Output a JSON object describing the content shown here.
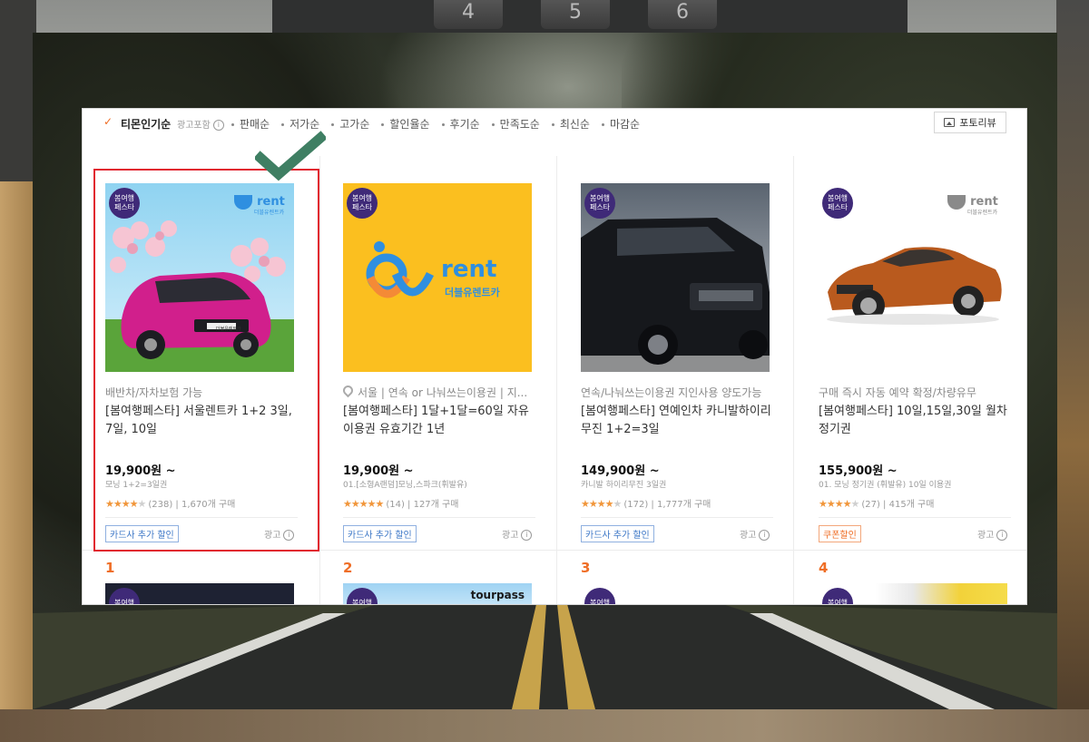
{
  "backdrop": {
    "keys": [
      "4",
      "5",
      "6"
    ]
  },
  "sort_bar": {
    "active_label": "티몬인기순",
    "ad_included": "광고포함",
    "items": [
      "판매순",
      "저가순",
      "고가순",
      "할인율순",
      "후기순",
      "만족도순",
      "최신순",
      "마감순"
    ],
    "photo_review_label": "포토리뷰"
  },
  "products": [
    {
      "badge": "봄여행 페스타",
      "brand_logo": "rent",
      "brand_logo_sub": "더블유렌트카",
      "car_plate": "더블유렌트카",
      "subtitle": "배반차/자차보험 가능",
      "title": "[봄여행페스타] 서울렌트카 1+2 3일, 7일, 10일",
      "price": "19,900원 ~",
      "option": "모닝 1+2=3일권",
      "rating_stars": 4.5,
      "review_count": "(238)",
      "sold": "1,670개 구매",
      "tag": "카드사 추가 할인",
      "tag_color": "blue",
      "ad": "광고"
    },
    {
      "badge": "봄여행 페스타",
      "brand_logo": "rent",
      "brand_logo_sub": "더블유렌트카",
      "subtitle": "서울 | 연속 or 나눠쓰는이용권 | 지...",
      "title": "[봄여행페스타] 1달+1달=60일 자유이용권 유효기간 1년",
      "price": "19,900원 ~",
      "option": "01.[소형A랜덤]모닝,스파크(휘발유)",
      "rating_stars": 5,
      "review_count": "(14)",
      "sold": "127개 구매",
      "tag": "카드사 추가 할인",
      "tag_color": "blue",
      "ad": "광고"
    },
    {
      "badge": "봄여행 페스타",
      "subtitle": "연속/나눠쓰는이용권 지인사용 양도가능",
      "title": "[봄여행페스타] 연예인차 카니발하이리무진 1+2=3일",
      "price": "149,900원 ~",
      "option": "카니발 하이리무진 3일권",
      "rating_stars": 4,
      "review_count": "(172)",
      "sold": "1,777개 구매",
      "tag": "카드사 추가 할인",
      "tag_color": "blue",
      "ad": "광고"
    },
    {
      "badge": "봄여행 페스타",
      "brand_logo": "rent",
      "brand_logo_sub": "더블유렌트카",
      "subtitle": "구매 즉시 자동 예약 확정/차량유무",
      "title": "[봄여행페스타] 10일,15일,30일 월차 정기권",
      "price": "155,900원 ~",
      "option": "01. 모닝 정기권 (휘발유) 10일 이용권",
      "rating_stars": 4,
      "review_count": "(27)",
      "sold": "415개 구매",
      "tag": "쿠폰할인",
      "tag_color": "orange",
      "ad": "광고"
    }
  ],
  "next_row": [
    {
      "rank": "1",
      "badge": "봄여행"
    },
    {
      "rank": "2",
      "badge": "봄여행",
      "logo": "tourpass"
    },
    {
      "rank": "3",
      "badge": "봄여행"
    },
    {
      "rank": "4",
      "badge": "봄여행"
    }
  ],
  "colors": {
    "accent": "#ef6e26",
    "badge": "#3f2a78",
    "highlight": "#e1232f",
    "checkmark": "#3f7f63",
    "star": "#f1963b"
  }
}
